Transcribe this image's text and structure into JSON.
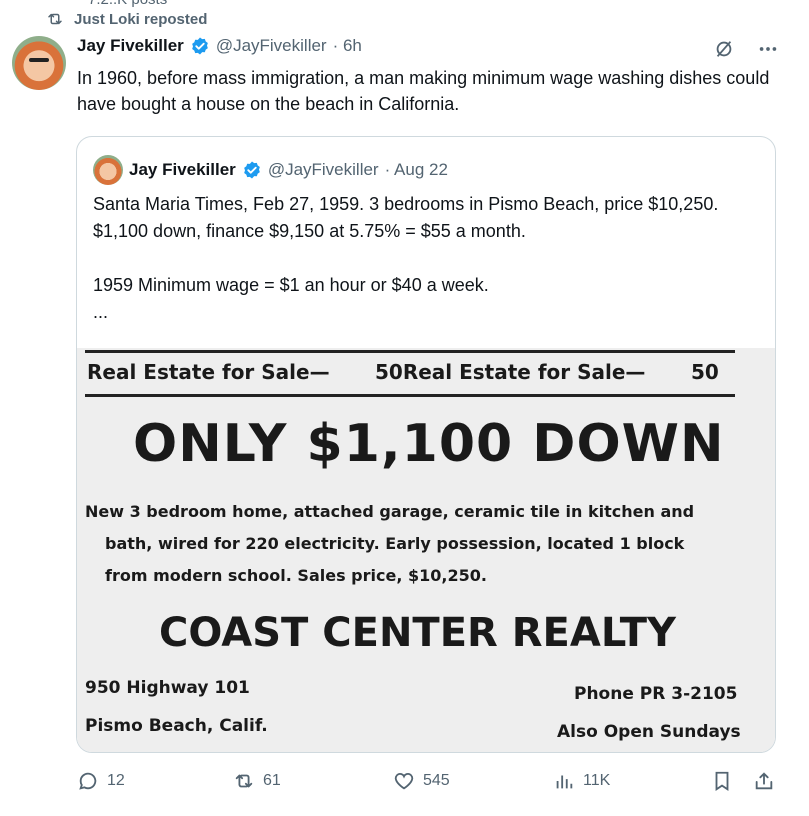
{
  "repost": {
    "top_cut_text": "7.2..K posts",
    "label": "Just Loki reposted"
  },
  "tweet": {
    "author_name": "Jay Fivekiller",
    "author_handle": "@JayFivekiller",
    "time": "· 6h",
    "text": "In 1960, before mass immigration, a man making minimum wage washing dishes could have bought a house on the beach in California."
  },
  "quote": {
    "author_name": "Jay Fivekiller",
    "author_handle": "@JayFivekiller",
    "time": "· Aug 22",
    "text": "Santa Maria Times, Feb 27, 1959. 3 bedrooms in Pismo Beach, price $10,250. $1,100 down, finance $9,150 at 5.75% = $55 a month.\n\n1959 Minimum wage = $1 an hour or $40 a week.\n..."
  },
  "ad": {
    "header_left": "Real Estate for Sale—",
    "header_mid": "50Real Estate for Sale—",
    "header_num": "50",
    "headline": "ONLY $1,100 DOWN",
    "body_line1": "New 3 bedroom home, attached garage, ceramic tile in kitchen and",
    "body_line2": "bath, wired for 220 electricity. Early possession, located 1 block",
    "body_line3": "from modern school. Sales price, $10,250.",
    "realty": "COAST CENTER REALTY",
    "address": "950 Highway 101",
    "city": "Pismo Beach, Calif.",
    "phone": "Phone PR 3-2105",
    "open": "Also Open Sundays"
  },
  "actions": {
    "replies": "12",
    "reposts": "61",
    "likes": "545",
    "views": "11K"
  },
  "colors": {
    "verified": "#1d9bf0",
    "muted": "#536471",
    "repost_green": "#00ba7c"
  },
  "icons": [
    "repost-icon",
    "verified-icon",
    "grok-icon",
    "more-icon",
    "reply-icon",
    "like-icon",
    "views-icon",
    "bookmark-icon",
    "share-icon"
  ]
}
